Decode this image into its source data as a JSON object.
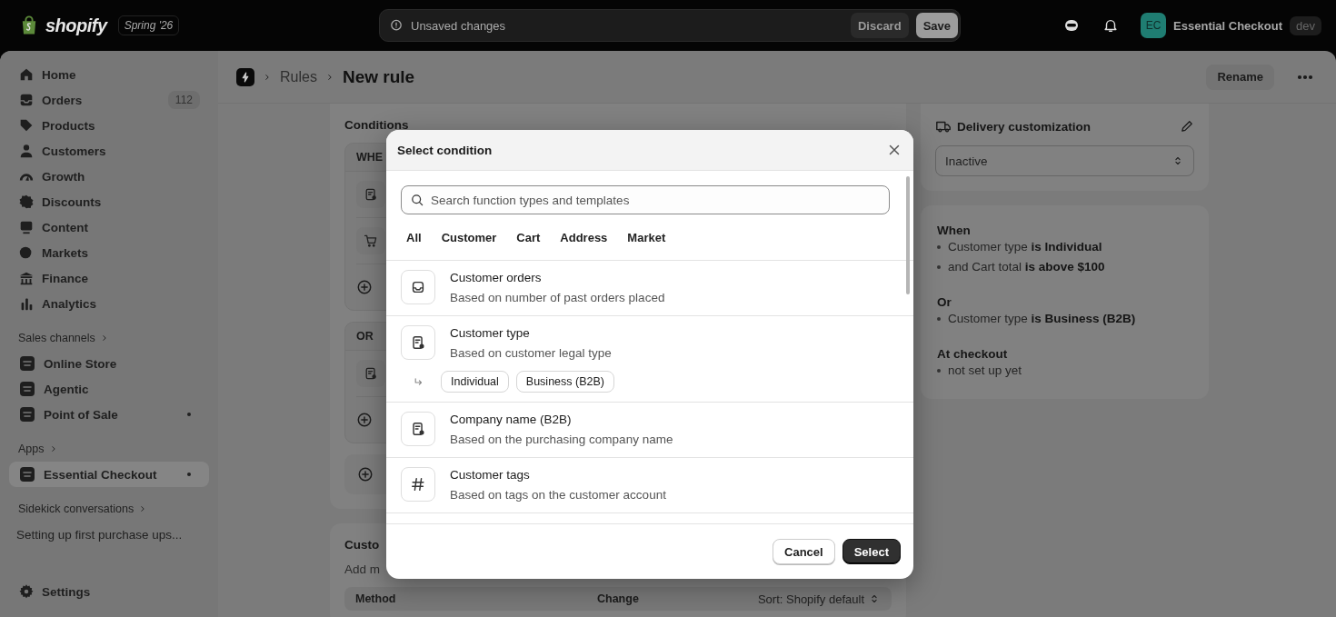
{
  "top_bar": {
    "logo": "shopify",
    "edition": "Spring '26",
    "notice": "Unsaved changes",
    "discard": "Discard",
    "save": "Save",
    "store_initials": "EC",
    "store_name": "Essential Checkout",
    "store_badge": "dev"
  },
  "sidebar": {
    "nav": [
      {
        "label": "Home",
        "selected": false
      },
      {
        "label": "Orders",
        "badge": "112",
        "selected": false
      },
      {
        "label": "Products",
        "selected": false
      },
      {
        "label": "Customers",
        "selected": false
      },
      {
        "label": "Growth",
        "selected": false
      },
      {
        "label": "Discounts",
        "selected": false
      },
      {
        "label": "Content",
        "selected": false
      },
      {
        "label": "Markets",
        "selected": false
      },
      {
        "label": "Finance",
        "selected": false
      },
      {
        "label": "Analytics",
        "selected": false
      }
    ],
    "sections": [
      {
        "heading": "Sales channels",
        "items": [
          {
            "label": "Online Store",
            "kind": "channel",
            "pinned": false,
            "selected": false
          },
          {
            "label": "Agentic",
            "kind": "channel",
            "pinned": false,
            "selected": false
          },
          {
            "label": "Point of Sale",
            "kind": "channel",
            "pinned": true,
            "selected": false
          }
        ]
      },
      {
        "heading": "Apps",
        "items": [
          {
            "label": "Essential Checkout",
            "kind": "app",
            "pinned": true,
            "selected": true
          }
        ]
      },
      {
        "heading": "Sidekick conversations",
        "items": [
          {
            "label": "Setting up first purchase ups...",
            "kind": "conversation",
            "pinned": false,
            "selected": false
          }
        ]
      }
    ],
    "settings": "Settings"
  },
  "page_header": {
    "breadcrumb": [
      "Rules"
    ],
    "title": "New rule",
    "rename": "Rename"
  },
  "conditions": {
    "title": "Conditions",
    "groups": [
      {
        "heading": "WHE",
        "rows": [
          {
            "kind": "form"
          },
          {
            "kind": "cart"
          },
          {
            "kind": "add"
          }
        ]
      },
      {
        "heading": "OR",
        "rows": [
          {
            "kind": "form"
          },
          {
            "kind": "add"
          }
        ]
      }
    ],
    "add_group": true
  },
  "customizations": {
    "title": "Custo",
    "subtitle": "Add m",
    "columns": [
      "Method",
      "Change"
    ],
    "sort": "Sort: Shopify default"
  },
  "delivery": {
    "title": "Delivery customization",
    "status": "Inactive"
  },
  "summary": [
    {
      "heading": "When",
      "lines": [
        "Customer type **is Individual**",
        "and Cart total **is above $100**"
      ]
    },
    {
      "heading": "Or",
      "lines": [
        "Customer type **is Business (B2B)**"
      ]
    },
    {
      "heading": "At checkout",
      "lines": [
        "not set up yet"
      ]
    }
  ],
  "modal": {
    "title": "Select condition",
    "search": {
      "placeholder": "Search function types and templates"
    },
    "tabs": [
      {
        "label": "All",
        "selected": false
      },
      {
        "label": "Customer",
        "selected": false
      },
      {
        "label": "Cart",
        "selected": false
      },
      {
        "label": "Address",
        "selected": false
      },
      {
        "label": "Market",
        "selected": false
      }
    ],
    "options": [
      {
        "kind": "orders",
        "title": "Customer orders",
        "description": "Based on number of past orders placed"
      },
      {
        "kind": "form",
        "title": "Customer type",
        "description": "Based on customer legal type",
        "values": [
          "Individual",
          "Business (B2B)"
        ]
      },
      {
        "kind": "form",
        "title": "Company name (B2B)",
        "description": "Based on the purchasing company name"
      },
      {
        "kind": "tags",
        "title": "Customer tags",
        "description": "Based on tags on the customer account"
      }
    ],
    "cancel": "Cancel",
    "select": "Select"
  }
}
